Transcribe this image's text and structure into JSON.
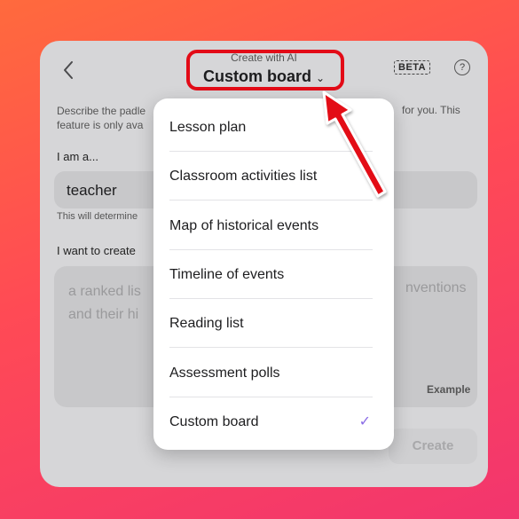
{
  "header": {
    "subtitle": "Create with AI",
    "title": "Custom board",
    "chevron": "⌄",
    "beta": "BETA",
    "help": "?"
  },
  "description": {
    "line1": "Describe the padle",
    "line2": "feature is only ava",
    "right": "for you. This"
  },
  "role": {
    "label": "I am a...",
    "value": "teacher",
    "hint": "This will determine"
  },
  "prompt": {
    "label": "I want to create",
    "text_line1": "a ranked lis",
    "text_line2": "and their hi",
    "text_right": "nventions",
    "example": "Example"
  },
  "create_label": "Create",
  "menu": {
    "items": [
      {
        "label": "Lesson plan"
      },
      {
        "label": "Classroom activities list"
      },
      {
        "label": "Map of historical events"
      },
      {
        "label": "Timeline of events"
      },
      {
        "label": "Reading list"
      },
      {
        "label": "Assessment polls"
      },
      {
        "label": "Custom board",
        "checked": "✓"
      }
    ]
  },
  "colors": {
    "highlight": "#e30b17",
    "check": "#8a6ce6"
  }
}
